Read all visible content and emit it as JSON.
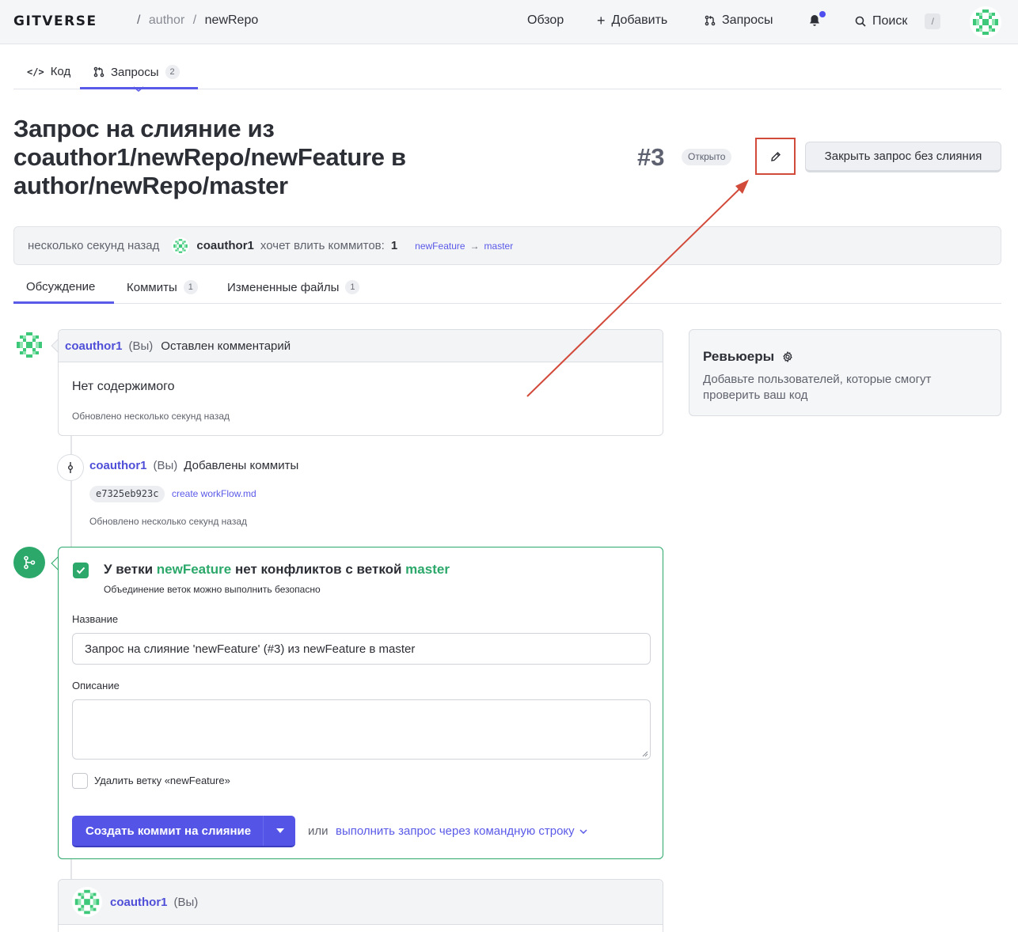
{
  "header": {
    "logo": "GITVERSE",
    "breadcrumb_owner": "author",
    "breadcrumb_sep": "/",
    "breadcrumb_repo": "newRepo",
    "nav": {
      "overview": "Обзор",
      "add": "Добавить",
      "requests": "Запросы",
      "search": "Поиск",
      "search_shortcut": "/"
    }
  },
  "repo_tabs": [
    {
      "label": "Код"
    },
    {
      "label": "Запросы",
      "count": "2"
    }
  ],
  "pr": {
    "title": "Запрос на слияние из coauthor1/newRepo/newFeature в author/newRepo/master",
    "number": "#3",
    "status": "Открыто",
    "close_button": "Закрыть запрос без слияния"
  },
  "summary": {
    "time": "несколько секунд назад",
    "user": "coauthor1",
    "wants": "хочет влить коммитов:",
    "count": "1",
    "source_branch": "newFeature",
    "arrow": "→",
    "target_branch": "master"
  },
  "discussion_tabs": [
    {
      "label": "Обсуждение"
    },
    {
      "label": "Коммиты",
      "count": "1"
    },
    {
      "label": "Измененные файлы",
      "count": "1"
    }
  ],
  "comment": {
    "user": "coauthor1",
    "you": "(Вы)",
    "action": "Оставлен комментарий",
    "body": "Нет содержимого",
    "updated": "Обновлено несколько секунд назад"
  },
  "commits_event": {
    "user": "coauthor1",
    "you": "(Вы)",
    "action": "Добавлены коммиты",
    "sha": "e7325eb923c",
    "message": "create workFlow.md",
    "updated": "Обновлено несколько секунд назад"
  },
  "merge": {
    "title_prefix": "У ветки",
    "branch": "newFeature",
    "title_middle": "нет конфликтов с веткой",
    "target": "master",
    "subtitle": "Объединение веток можно выполнить безопасно",
    "name_label": "Название",
    "name_value": "Запрос на слияние 'newFeature' (#3) из newFeature в master",
    "description_label": "Описание",
    "description_value": "",
    "delete_branch_label": "Удалить ветку «newFeature»",
    "delete_branch_checked": false,
    "merge_button": "Создать коммит на слияние",
    "or": "или",
    "cli_link": "выполнить запрос через командную строку"
  },
  "last_comment": {
    "user": "coauthor1",
    "you": "(Вы)"
  },
  "reviewers": {
    "title": "Ревьюеры",
    "text": "Добавьте пользователей, которые смогут проверить ваш код"
  },
  "colors": {
    "accent": "#5454e6",
    "success": "#2ba86a",
    "annotation": "#d24a3a",
    "notification_dot": "#4f4ff0"
  }
}
